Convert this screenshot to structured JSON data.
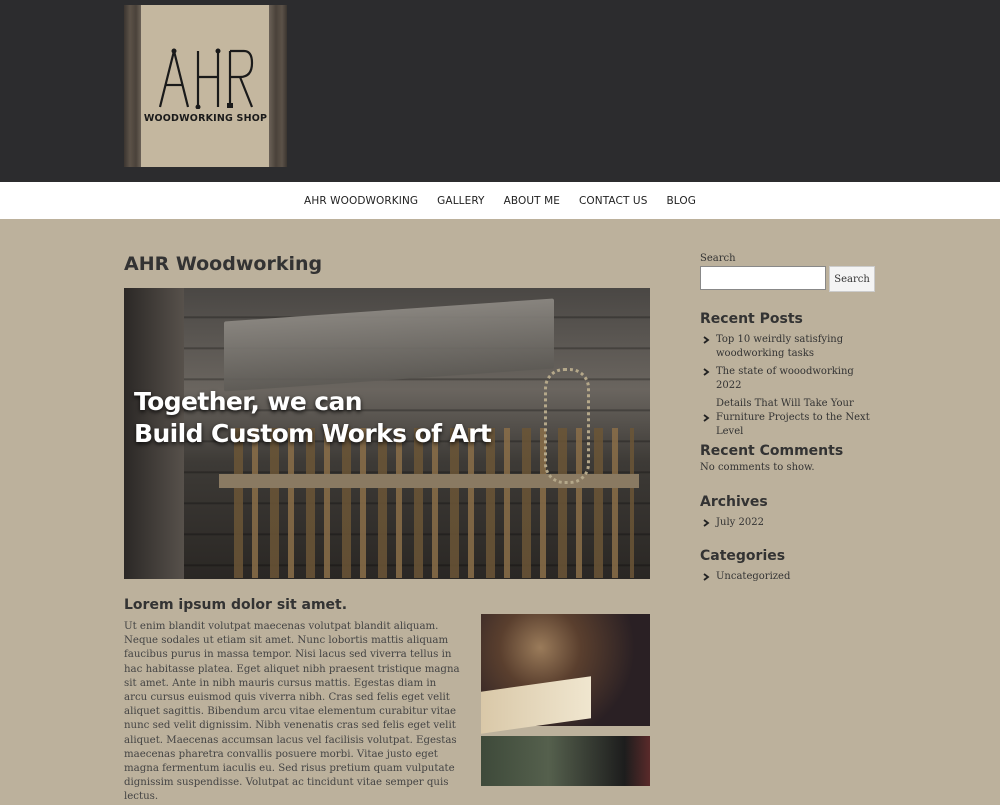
{
  "logo": {
    "mark": "AHR",
    "tagline": "WOODWORKING SHOP"
  },
  "nav": [
    {
      "label": "AHR WOODWORKING"
    },
    {
      "label": "GALLERY"
    },
    {
      "label": "ABOUT ME"
    },
    {
      "label": "CONTACT US"
    },
    {
      "label": "BLOG"
    }
  ],
  "page": {
    "title": "AHR Woodworking",
    "hero": {
      "line1": "Together, we can",
      "line2": "Build Custom Works of Art"
    },
    "post_title": "Lorem ipsum dolor sit amet.",
    "post_body": "Ut enim blandit volutpat maecenas volutpat blandit aliquam. Neque sodales ut etiam sit amet. Nunc lobortis mattis aliquam faucibus purus in massa tempor. Nisi lacus sed viverra tellus in hac habitasse platea. Eget aliquet nibh praesent tristique magna sit amet. Ante in nibh mauris cursus mattis. Egestas diam in arcu cursus euismod quis viverra nibh. Cras sed felis eget velit aliquet sagittis. Bibendum arcu vitae elementum curabitur vitae nunc sed velit dignissim. Nibh venenatis cras sed felis eget velit aliquet. Maecenas accumsan lacus vel facilisis volutpat. Egestas maecenas pharetra convallis posuere morbi. Vitae justo eget magna fermentum iaculis eu. Sed risus pretium quam vulputate dignissim suspendisse. Volutpat ac tincidunt vitae semper quis lectus."
  },
  "sidebar": {
    "search_label": "Search",
    "search_value": "",
    "search_button": "Search",
    "recent_posts_title": "Recent Posts",
    "recent_posts": [
      "Top 10 weirdly satisfying woodworking tasks",
      "The state of wooodworking 2022",
      "Details That Will Take Your Furniture Projects to the Next Level"
    ],
    "recent_comments_title": "Recent Comments",
    "no_comments": "No comments to show.",
    "archives_title": "Archives",
    "archives": [
      "July 2022"
    ],
    "categories_title": "Categories",
    "categories": [
      "Uncategorized"
    ]
  },
  "colors": {
    "header_bg": "#2c2c2e",
    "page_bg": "#bcb19c",
    "nav_bg": "#ffffff"
  }
}
